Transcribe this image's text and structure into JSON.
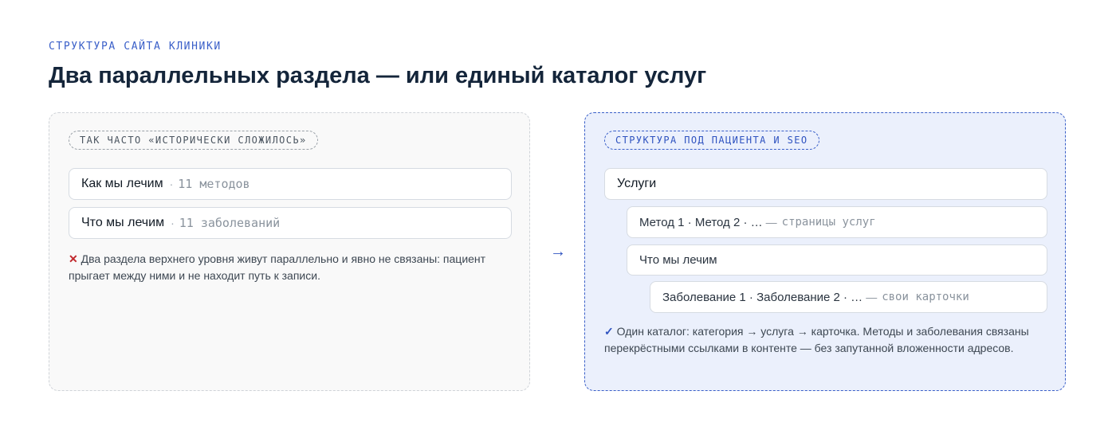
{
  "header": {
    "eyebrow": "СТРУКТУРА САЙТА КЛИНИКИ",
    "title": "Два параллельных раздела — или единый каталог услуг"
  },
  "left": {
    "chip": "ТАК ЧАСТО «ИСТОРИЧЕСКИ СЛОЖИЛОСЬ»",
    "rows": [
      {
        "label": "Как мы лечим",
        "sep": "·",
        "meta": "11 методов"
      },
      {
        "label": "Что мы лечим",
        "sep": "·",
        "meta": "11 заболеваний"
      }
    ],
    "note_mark": "✕",
    "note": "Два раздела верхнего уровня живут параллельно и явно не связаны: пациент прыгает между ними и не находит путь к записи."
  },
  "arrow": "→",
  "right": {
    "chip": "СТРУКТУРА ПОД ПАЦИЕНТА И SEO",
    "rows": [
      {
        "label": "Услуги"
      },
      {
        "label": "Метод 1 · Метод 2 · …",
        "dash": "—",
        "meta": "страницы услуг"
      },
      {
        "label": "Что мы лечим"
      },
      {
        "label": "Заболевание 1 · Заболевание 2 · …",
        "dash": "—",
        "meta": "свои карточки"
      }
    ],
    "note_mark": "✓",
    "note": "Один каталог: категория → услуга → карточка. Методы и заболевания связаны перекрёстными ссылками в контенте — без запутанной вложенности адресов."
  },
  "colors": {
    "accent": "#2f53c0",
    "heading": "#14253a",
    "left_panel_bg": "#f9f9f9",
    "right_panel_bg": "#ebf0fc",
    "error_mark": "#c0282d"
  }
}
